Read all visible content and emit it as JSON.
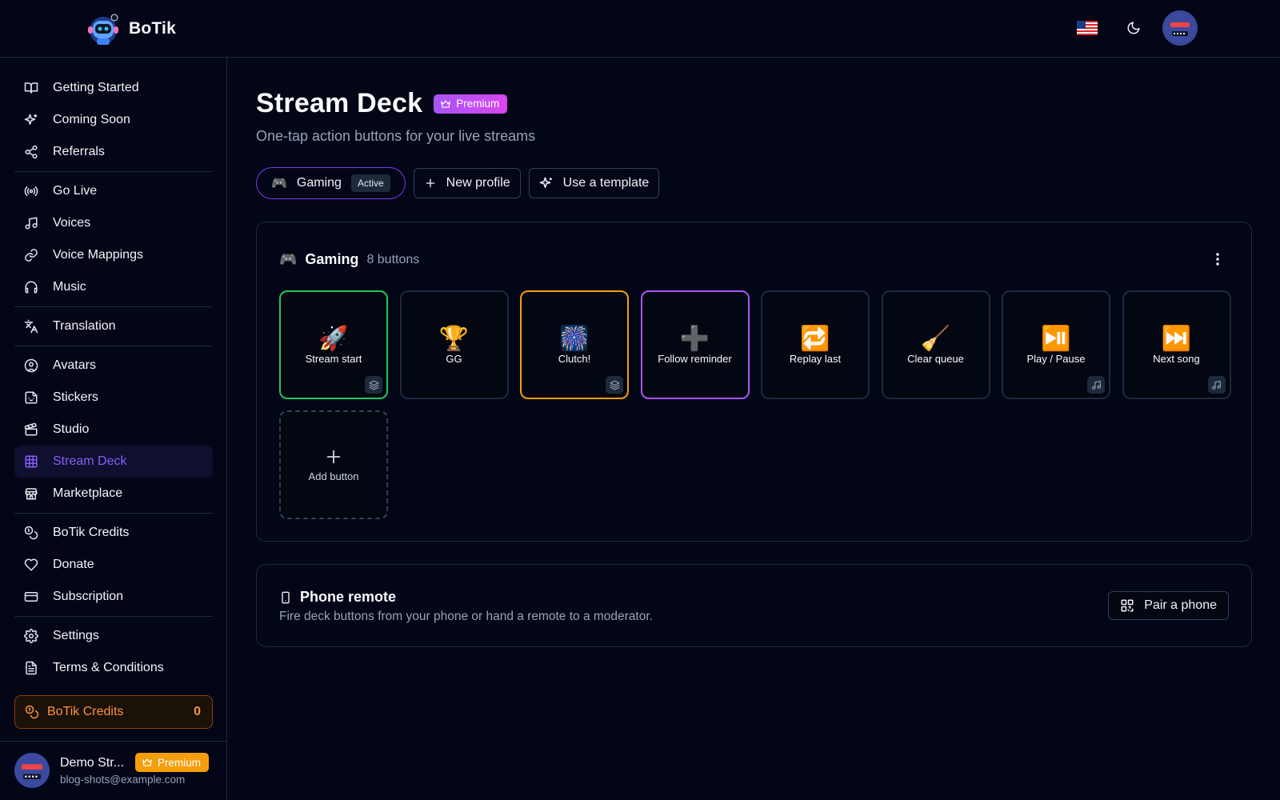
{
  "header": {
    "brand_name": "BoTik",
    "icons": [
      "us-flag-icon",
      "moon-icon",
      "avatar"
    ]
  },
  "sidebar": {
    "groups": [
      [
        {
          "label": "Getting Started",
          "icon": "book-open-icon"
        },
        {
          "label": "Coming Soon",
          "icon": "sparkles-icon"
        },
        {
          "label": "Referrals",
          "icon": "share-icon"
        }
      ],
      [
        {
          "label": "Go Live",
          "icon": "broadcast-icon"
        },
        {
          "label": "Voices",
          "icon": "music-note-icon"
        },
        {
          "label": "Voice Mappings",
          "icon": "link-icon"
        },
        {
          "label": "Music",
          "icon": "headphones-icon"
        }
      ],
      [
        {
          "label": "Translation",
          "icon": "languages-icon"
        }
      ],
      [
        {
          "label": "Avatars",
          "icon": "user-circle-icon"
        },
        {
          "label": "Stickers",
          "icon": "sticker-icon"
        },
        {
          "label": "Studio",
          "icon": "clapperboard-icon"
        },
        {
          "label": "Stream Deck",
          "icon": "grid-icon",
          "active": true
        },
        {
          "label": "Marketplace",
          "icon": "store-icon"
        }
      ],
      [
        {
          "label": "BoTik Credits",
          "icon": "coins-icon"
        },
        {
          "label": "Donate",
          "icon": "heart-icon"
        },
        {
          "label": "Subscription",
          "icon": "credit-card-icon"
        }
      ],
      [
        {
          "label": "Settings",
          "icon": "gear-icon"
        },
        {
          "label": "Terms & Conditions",
          "icon": "document-icon"
        }
      ]
    ],
    "credits": {
      "label": "BoTik Credits",
      "value": "0"
    },
    "user": {
      "name": "Demo Str...",
      "email": "blog-shots@example.com",
      "badge": "Premium"
    }
  },
  "main": {
    "title": "Stream Deck",
    "title_badge": "Premium",
    "subtitle": "One-tap action buttons for your live streams",
    "profiles": {
      "active": {
        "emoji": "🎮",
        "label": "Gaming",
        "tag": "Active"
      },
      "new_profile": "New profile",
      "use_template": "Use a template"
    },
    "deck": {
      "emoji": "🎮",
      "name": "Gaming",
      "count": "8 buttons",
      "buttons": [
        {
          "emoji": "🚀",
          "label": "Stream start",
          "border": "#22c55e",
          "corner": "layers-icon"
        },
        {
          "emoji": "🏆",
          "label": "GG",
          "border": "#1e293b",
          "corner": ""
        },
        {
          "emoji": "🎆",
          "label": "Clutch!",
          "border": "#f59e0b",
          "corner": "layers-icon"
        },
        {
          "emoji": "➕",
          "label": "Follow reminder",
          "border": "#a855f7",
          "corner": ""
        },
        {
          "emoji": "🔁",
          "label": "Replay last",
          "border": "#1e293b",
          "corner": ""
        },
        {
          "emoji": "🧹",
          "label": "Clear queue",
          "border": "#1e293b",
          "corner": ""
        },
        {
          "emoji": "⏯️",
          "label": "Play / Pause",
          "border": "#1e293b",
          "corner": "music-note-icon"
        },
        {
          "emoji": "⏭️",
          "label": "Next song",
          "border": "#1e293b",
          "corner": "music-note-icon"
        }
      ],
      "add_label": "Add button"
    },
    "remote": {
      "title": "Phone remote",
      "description": "Fire deck buttons from your phone or hand a remote to a moderator.",
      "button": "Pair a phone"
    }
  },
  "colors": {
    "background": "#020617",
    "accent": "#7c3aed",
    "credits": "#fb923c",
    "premium": "#f59e0b"
  }
}
